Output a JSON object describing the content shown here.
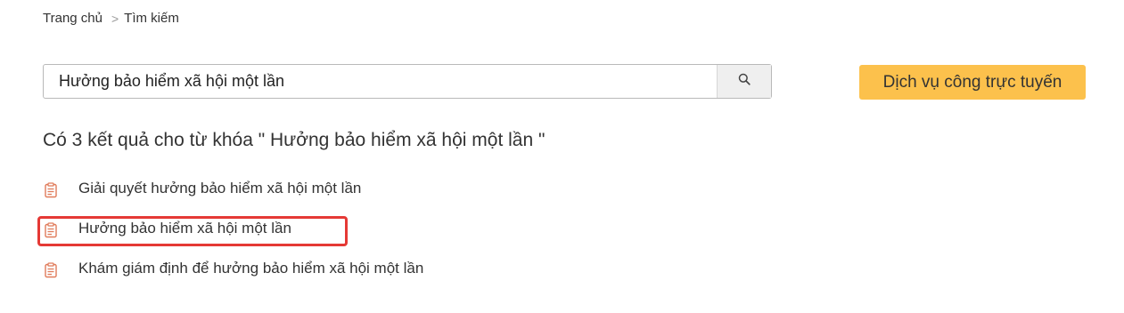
{
  "breadcrumb": {
    "home": "Trang chủ",
    "separator": ">",
    "current": "Tìm kiếm"
  },
  "search": {
    "value": "Hưởng bảo hiểm xã hội một lần",
    "button_icon": "search-icon"
  },
  "online_service": {
    "label": "Dịch vụ công trực tuyến",
    "color": "#fcc14c"
  },
  "results": {
    "heading": "Có 3 kết quả cho từ khóa \" Hưởng bảo hiểm xã hội một lần \"",
    "icon": "document-icon",
    "icon_color": "#e07b5a",
    "items": [
      {
        "label": "Giải quyết hưởng bảo hiểm xã hội một lần"
      },
      {
        "label": "Hưởng bảo hiểm xã hội một lần"
      },
      {
        "label": "Khám giám định để hưởng bảo hiểm xã hội một lần"
      }
    ],
    "highlight_color": "#e53935"
  }
}
